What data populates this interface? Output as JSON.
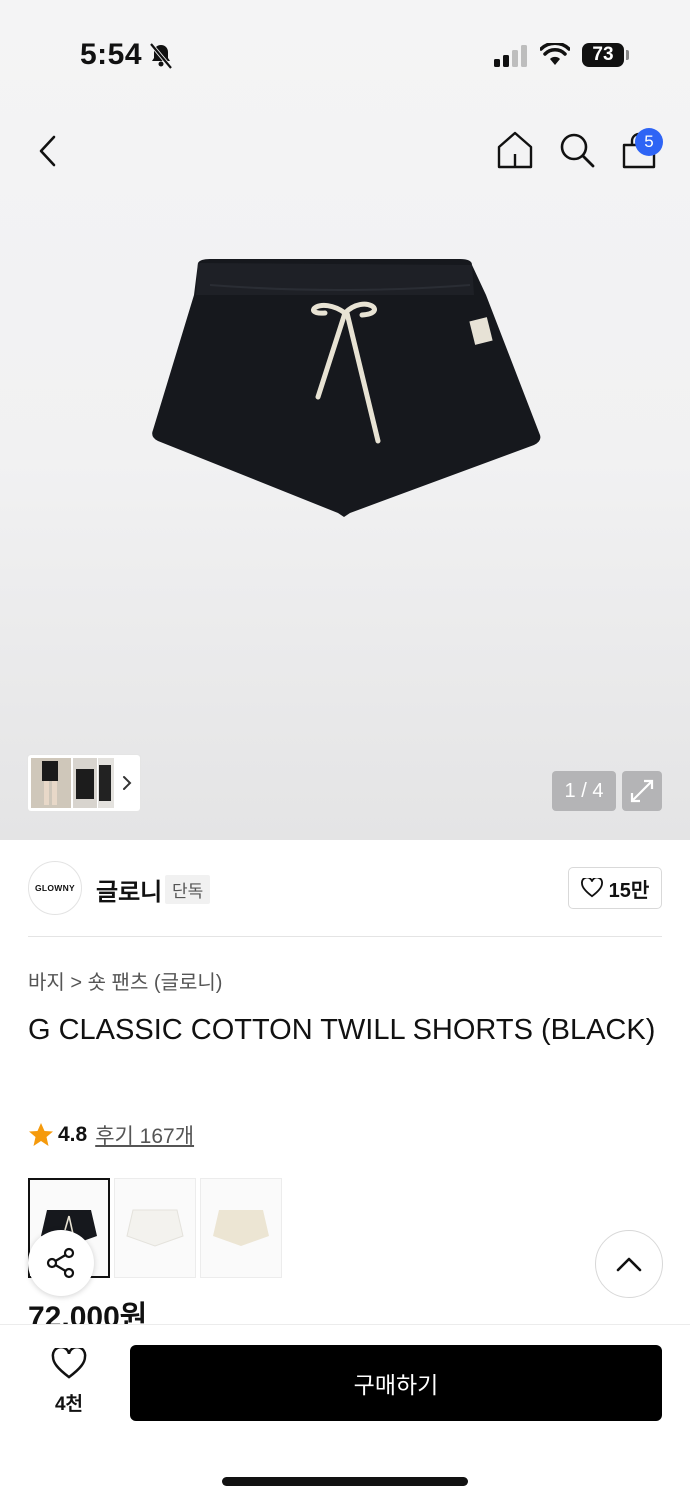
{
  "status": {
    "time": "5:54",
    "battery": "73"
  },
  "header": {
    "cart_count": "5"
  },
  "gallery": {
    "counter": "1 / 4"
  },
  "brand": {
    "logo_text": "GLOWNY",
    "name": "글로니",
    "badge": "단독",
    "likes": "15만"
  },
  "product": {
    "breadcrumb": "바지 > 숏 팬츠 (글로니)",
    "title": "G CLASSIC COTTON TWILL SHORTS (BLACK)",
    "rating": "4.8",
    "reviews": "후기 167개",
    "price": "72,000원",
    "options": [
      "black",
      "white",
      "cream"
    ]
  },
  "bottom": {
    "wish_count": "4천",
    "buy_label": "구매하기"
  }
}
